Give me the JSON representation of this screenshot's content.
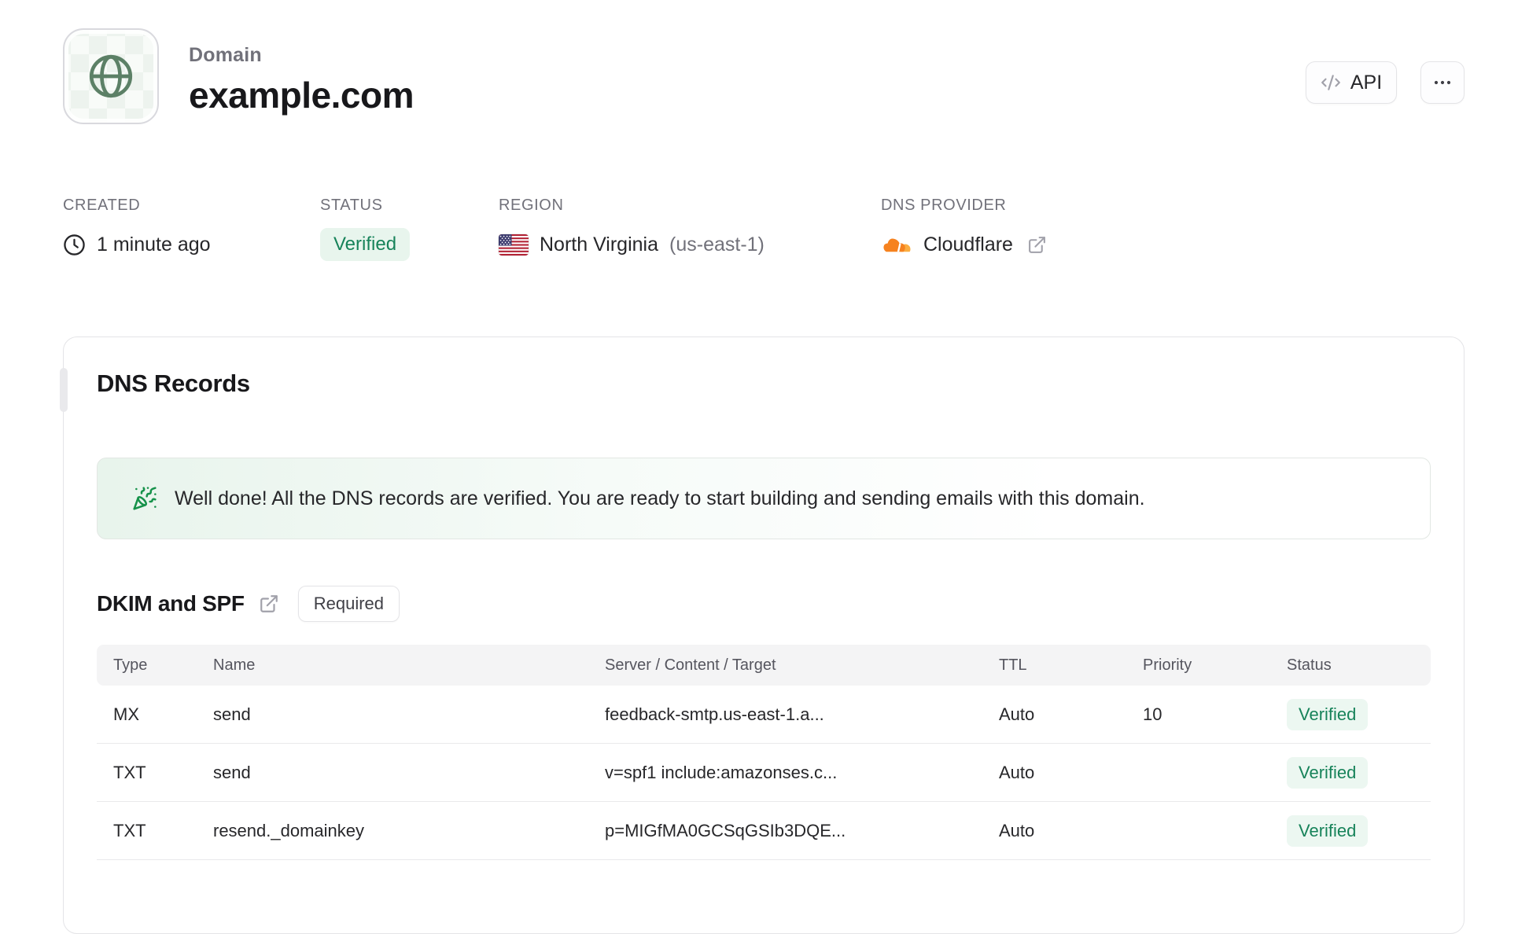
{
  "header": {
    "label": "Domain",
    "title": "example.com",
    "api_button_label": "API"
  },
  "meta": {
    "created": {
      "label": "CREATED",
      "value": "1 minute ago"
    },
    "status": {
      "label": "STATUS",
      "badge": "Verified"
    },
    "region": {
      "label": "REGION",
      "value": "North Virginia",
      "code": "(us-east-1)"
    },
    "dns_provider": {
      "label": "DNS PROVIDER",
      "value": "Cloudflare"
    }
  },
  "dns_card": {
    "title": "DNS Records",
    "banner_message": "Well done! All the DNS records are verified. You are ready to start building and sending emails with this domain.",
    "section_title": "DKIM and SPF",
    "section_badge": "Required",
    "table": {
      "columns": [
        "Type",
        "Name",
        "Server / Content / Target",
        "TTL",
        "Priority",
        "Status"
      ],
      "rows": [
        {
          "type": "MX",
          "name": "send",
          "content": "feedback-smtp.us-east-1.a...",
          "ttl": "Auto",
          "priority": "10",
          "status": "Verified"
        },
        {
          "type": "TXT",
          "name": "send",
          "content": "v=spf1 include:amazonses.c...",
          "ttl": "Auto",
          "priority": "",
          "status": "Verified"
        },
        {
          "type": "TXT",
          "name": "resend._domainkey",
          "content": "p=MIGfMA0GCSqGSIb3DQE...",
          "ttl": "Auto",
          "priority": "",
          "status": "Verified"
        }
      ]
    }
  },
  "colors": {
    "status_green_text": "#17835a",
    "status_green_bg": "#e8f5ed",
    "globe_green": "#5c8066",
    "cloudflare_orange": "#f6821f",
    "cloudflare_light_orange": "#fbad41",
    "banner_green_bg": "#e8f4ec"
  }
}
